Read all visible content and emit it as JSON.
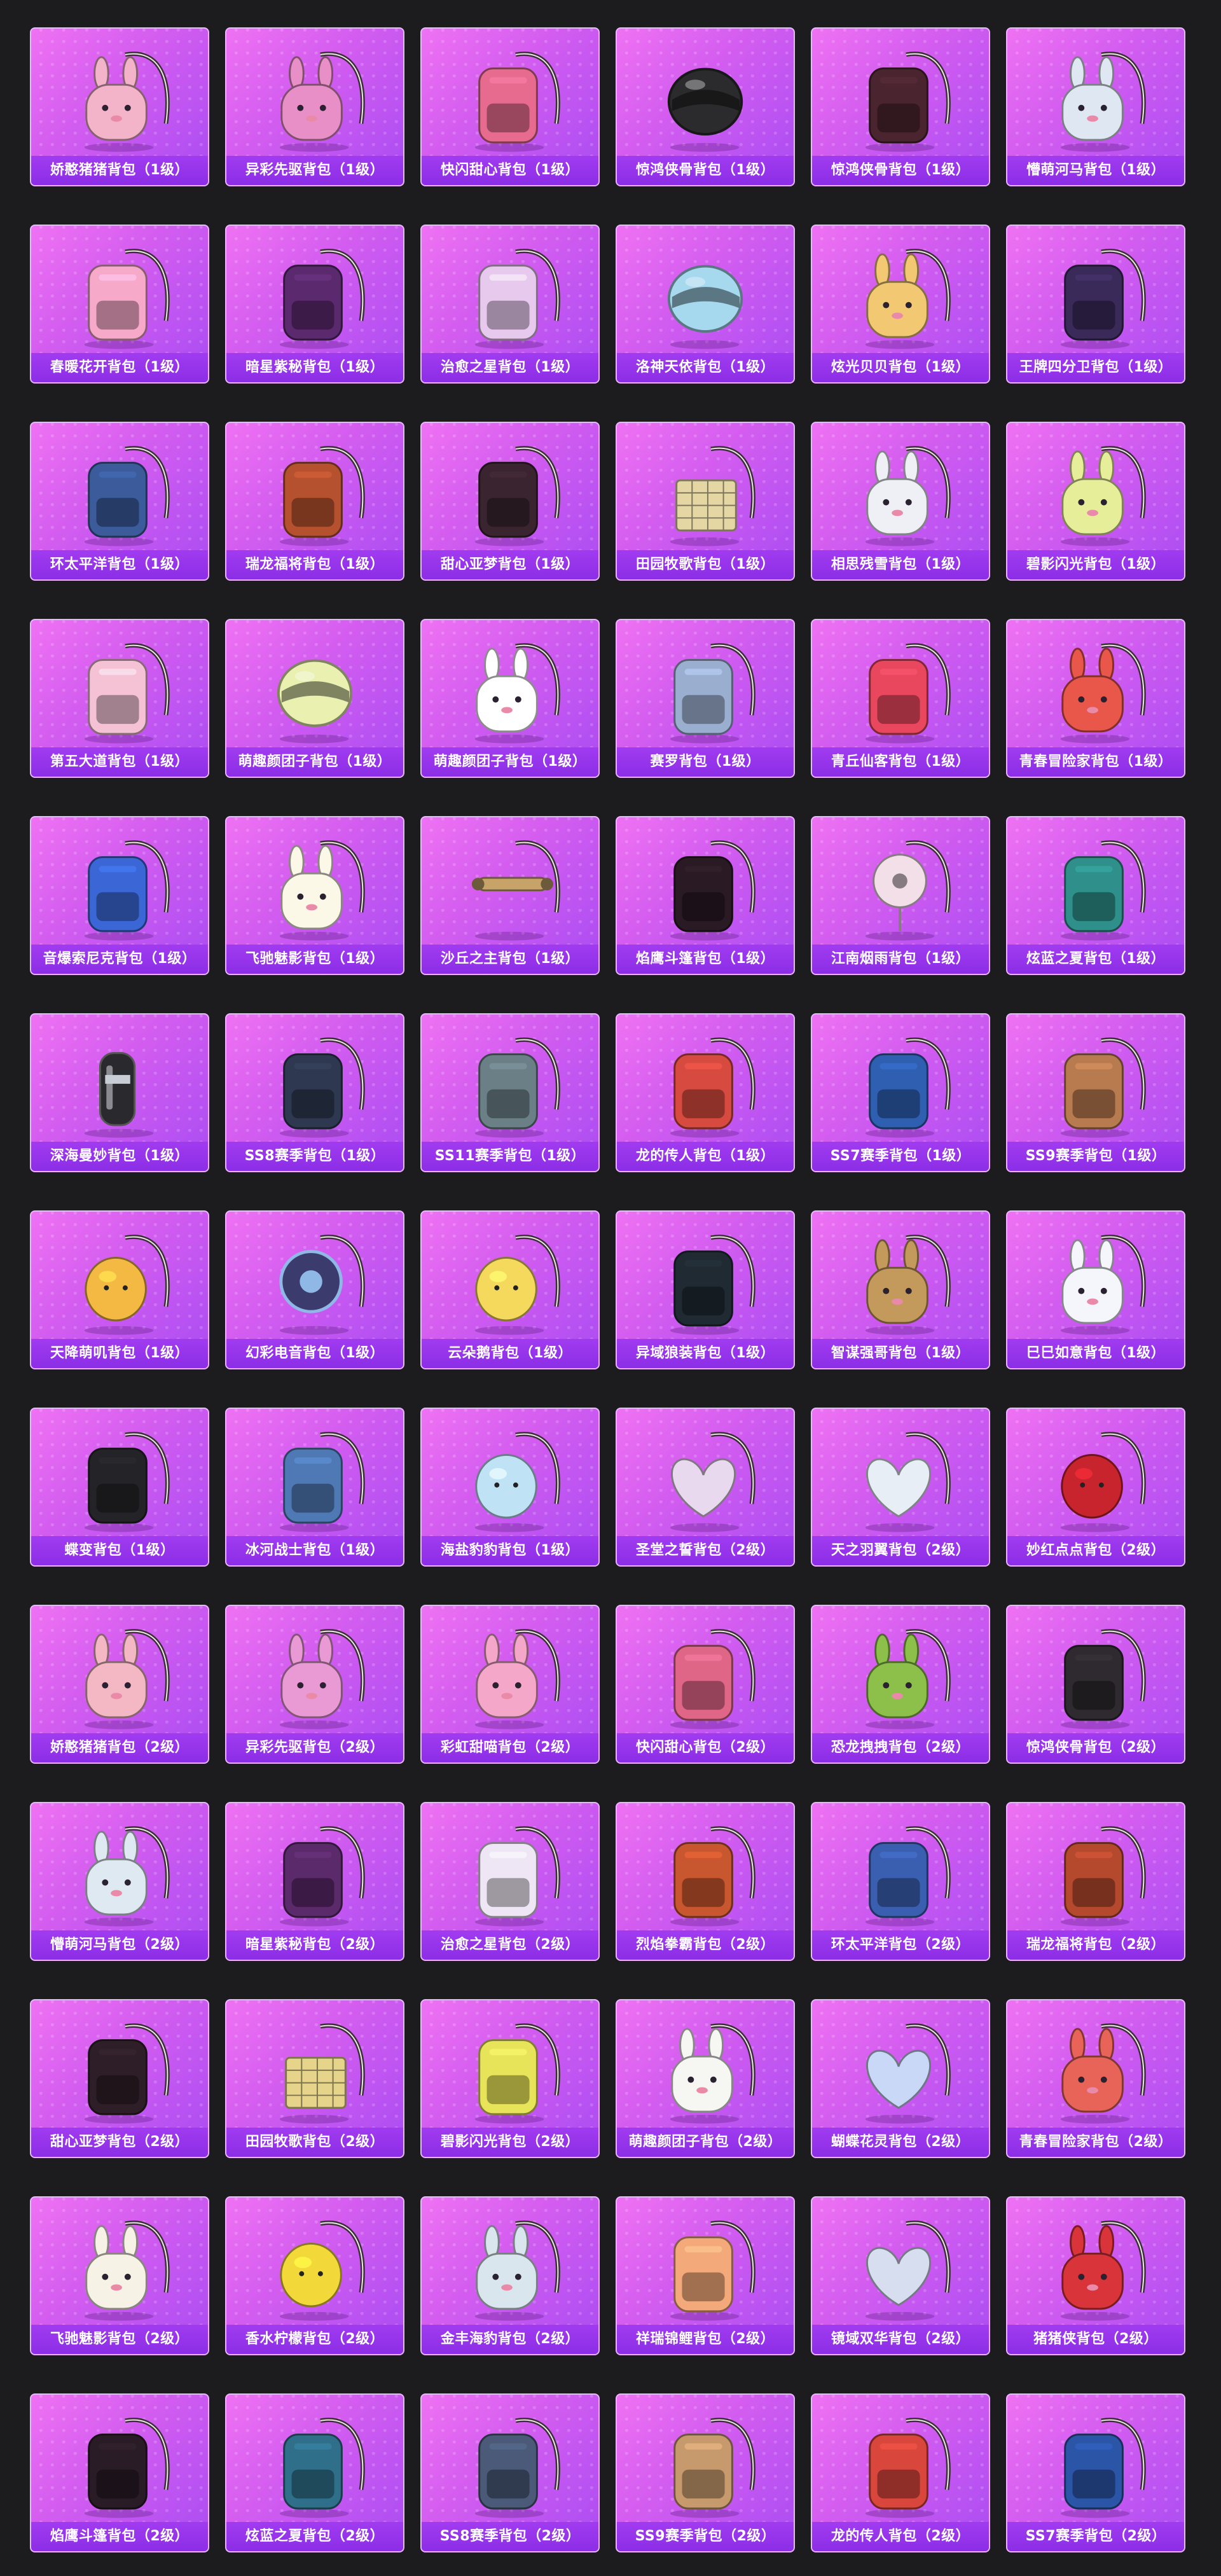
{
  "page": {
    "background_color": "#1c1c1e",
    "card_gradient": [
      "#ef72f3",
      "#a94cf3"
    ],
    "label_color": "#8b2ee6"
  },
  "items": [
    {
      "name": "娇憨猪猪背包（1级）",
      "icon": "pig-backpack-icon",
      "color": "#f3b3c8"
    },
    {
      "name": "异彩先驱背包（1级）",
      "icon": "bunny-backpack-icon",
      "color": "#e98fc7"
    },
    {
      "name": "快闪甜心背包（1级）",
      "icon": "camera-bag-icon",
      "color": "#e66b8e"
    },
    {
      "name": "惊鸿侠骨背包（1级）",
      "icon": "helmet-icon",
      "color": "#2b2b2e"
    },
    {
      "name": "惊鸿侠骨背包（1级）",
      "icon": "backpack-icon",
      "color": "#4a2530"
    },
    {
      "name": "懵萌河马背包（1级）",
      "icon": "hippo-backpack-icon",
      "color": "#dfe8f2"
    },
    {
      "name": "春暖花开背包（1级）",
      "icon": "flower-backpack-icon",
      "color": "#f6a9c9"
    },
    {
      "name": "暗星紫秘背包（1级）",
      "icon": "backpack-icon",
      "color": "#5b2a6e"
    },
    {
      "name": "治愈之星背包（1级）",
      "icon": "backpack-icon",
      "color": "#e8c9ee"
    },
    {
      "name": "洛神天依背包（1级）",
      "icon": "helmet-icon",
      "color": "#a6d8ee"
    },
    {
      "name": "炫光贝贝背包（1级）",
      "icon": "doll-backpack-icon",
      "color": "#f2c873"
    },
    {
      "name": "王牌四分卫背包（1级）",
      "icon": "backpack-icon",
      "color": "#3a2a5a"
    },
    {
      "name": "环太平洋背包（1级）",
      "icon": "mech-backpack-icon",
      "color": "#3b5b9a"
    },
    {
      "name": "瑞龙福将背包（1级）",
      "icon": "backpack-icon",
      "color": "#b5512f"
    },
    {
      "name": "甜心亚梦背包（1级）",
      "icon": "backpack-icon",
      "color": "#3a2430"
    },
    {
      "name": "田园牧歌背包（1级）",
      "icon": "basket-icon",
      "color": "#e5d7a4"
    },
    {
      "name": "相思残雪背包（1级）",
      "icon": "bunny-backpack-icon",
      "color": "#eef0f6"
    },
    {
      "name": "碧影闪光背包（1级）",
      "icon": "bunny-backpack-icon",
      "color": "#e6ee9a"
    },
    {
      "name": "第五大道背包（1级）",
      "icon": "purse-icon",
      "color": "#f4c2d4"
    },
    {
      "name": "萌趣颜团子背包（1级）",
      "icon": "helmet-icon",
      "color": "#e9f0b0"
    },
    {
      "name": "萌趣颜团子背包（1级）",
      "icon": "bunny-backpack-icon",
      "color": "#ffffff"
    },
    {
      "name": "赛罗背包（1级）",
      "icon": "mech-backpack-icon",
      "color": "#9aaed0"
    },
    {
      "name": "青丘仙客背包（1级）",
      "icon": "dress-icon",
      "color": "#e9475e"
    },
    {
      "name": "青春冒险家背包（1级）",
      "icon": "dino-backpack-icon",
      "color": "#e9564a"
    },
    {
      "name": "音爆索尼克背包（1级）",
      "icon": "backpack-icon",
      "color": "#3b67d6"
    },
    {
      "name": "飞驰魅影背包（1级）",
      "icon": "bunny-backpack-icon",
      "color": "#fbf8e8"
    },
    {
      "name": "沙丘之主背包（1级）",
      "icon": "scroll-icon",
      "color": "#c7a36a"
    },
    {
      "name": "焰鹰斗篷背包（1级）",
      "icon": "backpack-icon",
      "color": "#2a1a24"
    },
    {
      "name": "江南烟雨背包（1级）",
      "icon": "fan-icon",
      "color": "#f3dfe8"
    },
    {
      "name": "炫蓝之夏背包（1级）",
      "icon": "backpack-icon",
      "color": "#2f8f8a"
    },
    {
      "name": "深海曼妙背包（1级）",
      "icon": "tank-icon",
      "color": "#2a2a2e"
    },
    {
      "name": "SS8赛季背包（1级）",
      "icon": "backpack-icon",
      "color": "#2e3850"
    },
    {
      "name": "SS11赛季背包（1级）",
      "icon": "backpack-icon",
      "color": "#6b7f86"
    },
    {
      "name": "龙的传人背包（1级）",
      "icon": "backpack-icon",
      "color": "#d64a3f"
    },
    {
      "name": "SS7赛季背包（1级）",
      "icon": "backpack-icon",
      "color": "#2f5fb0"
    },
    {
      "name": "SS9赛季背包（1级）",
      "icon": "backpack-icon",
      "color": "#b87a4f"
    },
    {
      "name": "天降萌叽背包（1级）",
      "icon": "chick-backpack-icon",
      "color": "#f4b942"
    },
    {
      "name": "幻彩电音背包（1级）",
      "icon": "speaker-icon",
      "color": "#3b3b6e"
    },
    {
      "name": "云朵鹅背包（1级）",
      "icon": "cloud-icon",
      "color": "#f4d95c"
    },
    {
      "name": "异域狼装背包（1级）",
      "icon": "backpack-icon",
      "color": "#1f2a33"
    },
    {
      "name": "智谋强哥背包（1级）",
      "icon": "face-backpack-icon",
      "color": "#c49a5c"
    },
    {
      "name": "巳巳如意背包（1级）",
      "icon": "bunny-backpack-icon",
      "color": "#f4f6fb"
    },
    {
      "name": "蝶变背包（1级）",
      "icon": "backpack-icon",
      "color": "#242428"
    },
    {
      "name": "冰河战士背包（1级）",
      "icon": "backpack-icon",
      "color": "#4f79b4"
    },
    {
      "name": "海盐豹豹背包（1级）",
      "icon": "cloud-icon",
      "color": "#bfe2f5"
    },
    {
      "name": "圣堂之誓背包（2级）",
      "icon": "heart-backpack-icon",
      "color": "#e8d9ee"
    },
    {
      "name": "天之羽翼背包（2级）",
      "icon": "wing-backpack-icon",
      "color": "#e8eef5"
    },
    {
      "name": "妙红点点背包（2级）",
      "icon": "ladybug-icon",
      "color": "#c8242e"
    },
    {
      "name": "娇憨猪猪背包（2级）",
      "icon": "pig-backpack-icon",
      "color": "#f3b8c3"
    },
    {
      "name": "异彩先驱背包（2级）",
      "icon": "bunny-backpack-icon",
      "color": "#e99ad4"
    },
    {
      "name": "彩虹甜喵背包（2级）",
      "icon": "cat-backpack-icon",
      "color": "#f4a7c8"
    },
    {
      "name": "快闪甜心背包（2级）",
      "icon": "camera-bag-icon",
      "color": "#e06688"
    },
    {
      "name": "恐龙拽拽背包（2级）",
      "icon": "dino-backpack-icon",
      "color": "#8cc04a"
    },
    {
      "name": "惊鸿侠骨背包（2级）",
      "icon": "backpack-icon",
      "color": "#2e2a30"
    },
    {
      "name": "懵萌河马背包（2级）",
      "icon": "hippo-backpack-icon",
      "color": "#dfe9f2"
    },
    {
      "name": "暗星紫秘背包（2级）",
      "icon": "backpack-icon",
      "color": "#5a2a6a"
    },
    {
      "name": "治愈之星背包（2级）",
      "icon": "backpack-icon",
      "color": "#eee6f4"
    },
    {
      "name": "烈焰拳霸背包（2级）",
      "icon": "backpack-icon",
      "color": "#c8562f"
    },
    {
      "name": "环太平洋背包（2级）",
      "icon": "mech-backpack-icon",
      "color": "#3a5fb0"
    },
    {
      "name": "瑞龙福将背包（2级）",
      "icon": "backpack-icon",
      "color": "#b5492e"
    },
    {
      "name": "甜心亚梦背包（2级）",
      "icon": "backpack-icon",
      "color": "#2e1e28"
    },
    {
      "name": "田园牧歌背包（2级）",
      "icon": "basket-icon",
      "color": "#e5d48a"
    },
    {
      "name": "碧影闪光背包（2级）",
      "icon": "gamepad-icon",
      "color": "#e8e45a"
    },
    {
      "name": "萌趣颜团子背包（2级）",
      "icon": "bunny-backpack-icon",
      "color": "#f6f6f2"
    },
    {
      "name": "蝴蝶花灵背包（2级）",
      "icon": "butterfly-icon",
      "color": "#c9d8f6"
    },
    {
      "name": "青春冒险家背包（2级）",
      "icon": "dino-backpack-icon",
      "color": "#e96458"
    },
    {
      "name": "飞驰魅影背包（2级）",
      "icon": "bunny-backpack-icon",
      "color": "#f7f2e6"
    },
    {
      "name": "香水柠檬背包（2级）",
      "icon": "lemon-icon",
      "color": "#f3d83a"
    },
    {
      "name": "金丰海豹背包（2级）",
      "icon": "seal-backpack-icon",
      "color": "#d9e6ee"
    },
    {
      "name": "祥瑞锦鲤背包（2级）",
      "icon": "fish-backpack-icon",
      "color": "#f3a97a"
    },
    {
      "name": "镜域双华背包（2级）",
      "icon": "heart-backpack-icon",
      "color": "#d6def0"
    },
    {
      "name": "猪猪侠背包（2级）",
      "icon": "pig-backpack-icon",
      "color": "#d8343a"
    },
    {
      "name": "焰鹰斗篷背包（2级）",
      "icon": "backpack-icon",
      "color": "#2a1c26"
    },
    {
      "name": "炫蓝之夏背包（2级）",
      "icon": "backpack-icon",
      "color": "#2f6f8a"
    },
    {
      "name": "SS8赛季背包（2级）",
      "icon": "backpack-icon",
      "color": "#4a5a78"
    },
    {
      "name": "SS9赛季背包（2级）",
      "icon": "backpack-icon",
      "color": "#c79a6e"
    },
    {
      "name": "龙的传人背包（2级）",
      "icon": "backpack-icon",
      "color": "#d8463c"
    },
    {
      "name": "SS7赛季背包（2级）",
      "icon": "backpack-icon",
      "color": "#2b55a6"
    }
  ]
}
